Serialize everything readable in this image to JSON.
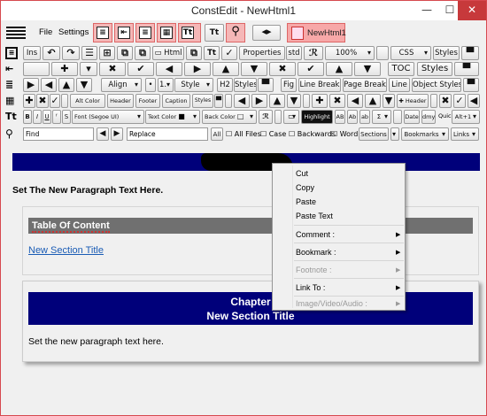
{
  "window": {
    "title": "ConstEdit - NewHtml1",
    "minimize": "—",
    "maximize": "☐",
    "close": "✕"
  },
  "menu": {
    "file": "File",
    "settings": "Settings"
  },
  "doc_tab": {
    "label": "NewHtml1"
  },
  "toolbar1": {
    "ins": "Ins",
    "html": "Html",
    "tt": "Tt",
    "properties": "Properties",
    "std": "std",
    "zoom": "100%",
    "css": "CSS",
    "styles": "Styles"
  },
  "toolbar2": {
    "toc": "TOC",
    "styles": "Styles"
  },
  "toolbar3": {
    "align": "Align",
    "one": "1.",
    "style": "Style",
    "h2": "H2",
    "styles": "Styles",
    "fig": "Fig",
    "line_break": "Line Break",
    "page_break": "Page Break",
    "line": "Line",
    "object_styles": "Object Styles"
  },
  "toolbar4": {
    "alt_color": "Alt Color",
    "header": "Header",
    "footer": "Footer",
    "caption": "Caption",
    "styles": "Styles",
    "header2": "Header"
  },
  "toolbar5": {
    "b": "B",
    "i": "I",
    "u": "U",
    "font": "Font",
    "font_value": "(Segoe UI)",
    "text_color": "Text Color",
    "back_color": "Back Color",
    "highlight": "Highlight",
    "ab1": "AB",
    "ab2": "Ab",
    "ab3": "ab",
    "date": "Date",
    "dmy": "dmy",
    "quick": "Quick",
    "alt1": "Alt+1"
  },
  "findbar": {
    "find": "Find",
    "replace": "Replace",
    "all": "All",
    "all_files": "All Files",
    "case": "Case",
    "backwards": "Backwards",
    "word": "Word",
    "sections": "Sections",
    "bookmarks": "Bookmarks",
    "links": "Links"
  },
  "document": {
    "paragraph1": "Set The New Paragraph Text Here.",
    "toc_title": "Table Of Content",
    "toc_link": "New Section Title",
    "chapter_line1": "Chapter",
    "chapter_line2": "New Section Title",
    "paragraph2": "Set the new paragraph text here."
  },
  "context_menu": {
    "cut": "Cut",
    "copy": "Copy",
    "paste": "Paste",
    "paste_text": "Paste Text",
    "comment": "Comment :",
    "bookmark": "Bookmark :",
    "footnote": "Footnote :",
    "link_to": "Link To :",
    "image": "Image/Video/Audio :"
  },
  "colors": {
    "accent_blue": "#00007a",
    "toc_gray": "#707070",
    "link": "#1a5cb5",
    "window_border": "#d6494f"
  }
}
